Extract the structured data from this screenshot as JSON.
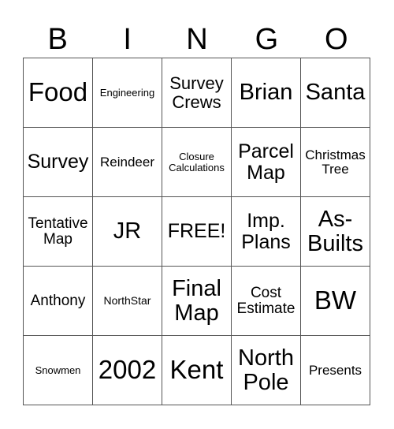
{
  "header": {
    "letters": [
      "B",
      "I",
      "N",
      "G",
      "O"
    ]
  },
  "cells": [
    [
      "Food",
      "Engineering",
      "Survey Crews",
      "Brian",
      "Santa"
    ],
    [
      "Survey",
      "Reindeer",
      "Closure Calculations",
      "Parcel Map",
      "Christmas Tree"
    ],
    [
      "Tentative Map",
      "JR",
      "FREE!",
      "Imp. Plans",
      "As-Builts"
    ],
    [
      "Anthony",
      "NorthStar",
      "Final Map",
      "Cost Estimate",
      "BW"
    ],
    [
      "Snowmen",
      "2002",
      "Kent",
      "North Pole",
      "Presents"
    ]
  ]
}
